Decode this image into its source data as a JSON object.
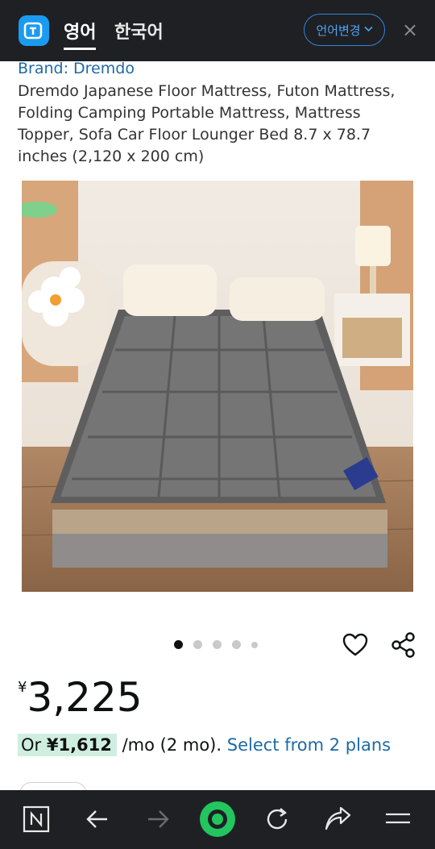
{
  "topbar": {
    "lang_active": "영어",
    "lang_other": "한국어",
    "lang_change": "언어변경",
    "close": "×",
    "colors": {
      "accent": "#2f86e0",
      "bg": "#1f2023"
    }
  },
  "product": {
    "brand": "Brand: Dremdo",
    "title": "Dremdo Japanese Floor Mattress, Futon Mattress, Folding Camping Portable Mattress, Mattress Topper, Sofa Car Floor Lounger Bed 8.7 x 78.7 inches (2,120 x 200 cm)",
    "image_icon": "product-photo-gray-futon-mattress",
    "carousel": {
      "count": 5,
      "active_index": 0
    }
  },
  "price": {
    "currency": "¥",
    "amount": "3,225"
  },
  "plan": {
    "prefix": "Or",
    "monthly": "¥1,612",
    "suffix": "/mo (2 mo).",
    "link": "Select from 2 plans",
    "highlight_color": "#cfeee0"
  },
  "bottombar": {
    "icons": [
      "tabs-icon",
      "back-icon",
      "forward-icon",
      "home-icon",
      "reload-icon",
      "share-icon",
      "menu-icon"
    ],
    "accent": "#22c55e"
  }
}
